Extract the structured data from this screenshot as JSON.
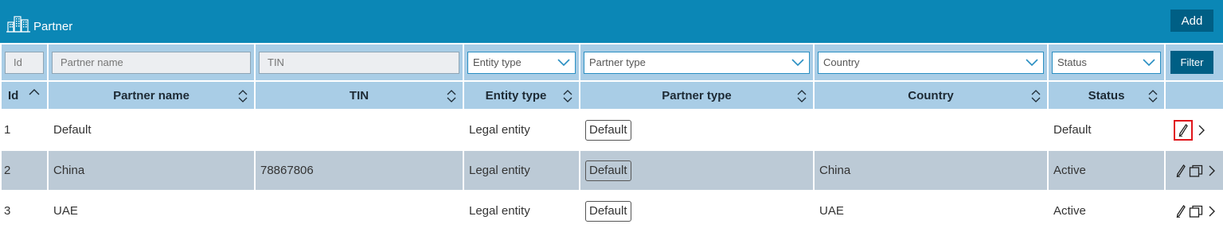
{
  "header": {
    "title": "Partner",
    "icon": "buildings-icon",
    "add_label": "Add"
  },
  "filters": {
    "id_placeholder": "Id",
    "partner_name_placeholder": "Partner name",
    "tin_placeholder": "TIN",
    "entity_type_value": "Entity type",
    "partner_type_value": "Partner type",
    "country_value": "Country",
    "status_value": "Status",
    "filter_label": "Filter"
  },
  "columns": {
    "id": "Id",
    "partner_name": "Partner name",
    "tin": "TIN",
    "entity_type": "Entity type",
    "partner_type": "Partner type",
    "country": "Country",
    "status": "Status"
  },
  "rows": [
    {
      "id": "1",
      "partner_name": "Default",
      "tin": "",
      "entity_type": "Legal entity",
      "partner_type": "Default",
      "country": "",
      "status": "Default"
    },
    {
      "id": "2",
      "partner_name": "China",
      "tin": "78867806",
      "entity_type": "Legal entity",
      "partner_type": "Default",
      "country": "China",
      "status": "Active"
    },
    {
      "id": "3",
      "partner_name": "UAE",
      "tin": "",
      "entity_type": "Legal entity",
      "partner_type": "Default",
      "country": "UAE",
      "status": "Active"
    }
  ],
  "colors": {
    "header_bg": "#0b87b6",
    "button_bg": "#005f85",
    "grid_header_bg": "#a9cde6",
    "alt_row_bg": "#bccad6",
    "highlight": "#e0151b"
  }
}
